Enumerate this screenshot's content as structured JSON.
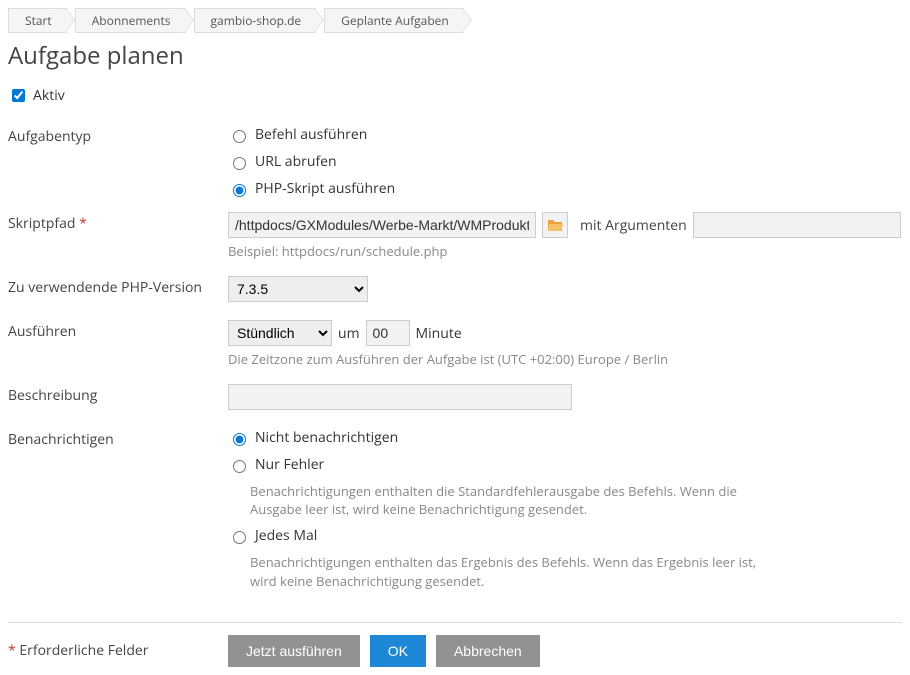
{
  "breadcrumb": [
    "Start",
    "Abonnements",
    "gambio-shop.de",
    "Geplante Aufgaben"
  ],
  "title": "Aufgabe planen",
  "active": {
    "label": "Aktiv",
    "checked": true
  },
  "taskType": {
    "label": "Aufgabentyp",
    "options": [
      {
        "label": "Befehl ausführen",
        "checked": false
      },
      {
        "label": "URL abrufen",
        "checked": false
      },
      {
        "label": "PHP-Skript ausführen",
        "checked": true
      }
    ]
  },
  "scriptPath": {
    "label": "Skriptpfad",
    "required": "*",
    "value": "/httpdocs/GXModules/Werbe-Markt/WMProduktVe",
    "argsLabel": "mit Argumenten",
    "argsValue": "",
    "hint": "Beispiel: httpdocs/run/schedule.php"
  },
  "phpVersion": {
    "label": "Zu verwendende PHP-Version",
    "value": "7.3.5"
  },
  "execute": {
    "label": "Ausführen",
    "interval": "Stündlich",
    "atLabel": "um",
    "minute": "00",
    "minuteLabel": "Minute",
    "tzHint": "Die Zeitzone zum Ausführen der Aufgabe ist (UTC +02:00) Europe / Berlin"
  },
  "description": {
    "label": "Beschreibung",
    "value": ""
  },
  "notify": {
    "label": "Benachrichtigen",
    "options": [
      {
        "label": "Nicht benachrichtigen",
        "checked": true,
        "hint": ""
      },
      {
        "label": "Nur Fehler",
        "checked": false,
        "hint": "Benachrichtigungen enthalten die Standardfehlerausgabe des Befehls. Wenn die Ausgabe leer ist, wird keine Benachrichtigung gesendet."
      },
      {
        "label": "Jedes Mal",
        "checked": false,
        "hint": "Benachrichtigungen enthalten das Ergebnis des Befehls. Wenn das Ergebnis leer ist, wird keine Benachrichtigung gesendet."
      }
    ]
  },
  "footer": {
    "requiredNote": "Erforderliche Felder",
    "requiredMark": "*",
    "runNow": "Jetzt ausführen",
    "ok": "OK",
    "cancel": "Abbrechen"
  }
}
